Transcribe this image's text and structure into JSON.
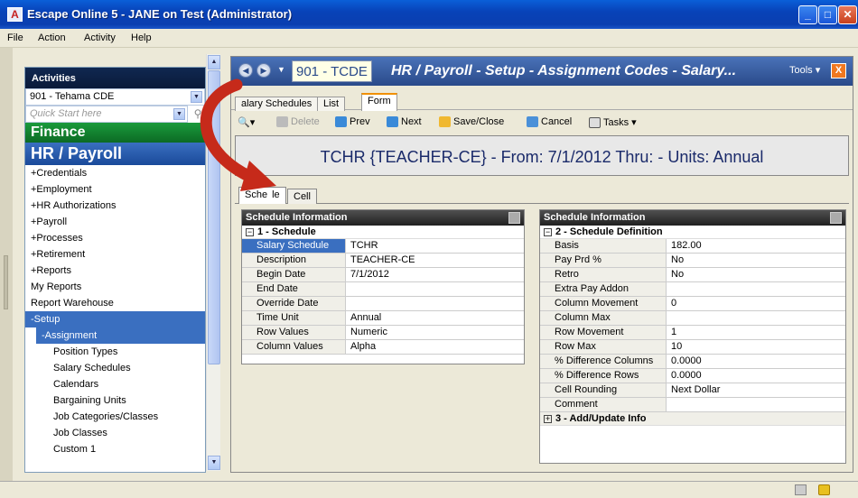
{
  "window": {
    "title": "Escape Online 5 - JANE on Test (Administrator)",
    "app_icon_letter": "A"
  },
  "menu": [
    "File",
    "Action",
    "Activity",
    "Help"
  ],
  "activities": {
    "title": "Activities",
    "district": "901 - Tehama CDE",
    "quick_start_placeholder": "Quick Start here",
    "finance": "Finance",
    "hr_payroll": "HR / Payroll",
    "items": [
      "+Credentials",
      "+Employment",
      "+HR Authorizations",
      "+Payroll",
      "+Processes",
      "+Retirement",
      "+Reports",
      "My Reports",
      "Report Warehouse"
    ],
    "setup": "-Setup",
    "assignment": "-Assignment",
    "sub_items": [
      "Position Types",
      "Salary Schedules",
      "Calendars",
      "Bargaining Units",
      "Job Categories/Classes",
      "Job Classes",
      "Custom 1"
    ]
  },
  "main": {
    "code": "901 - TCDE",
    "title": "HR / Payroll - Setup - Assignment Codes - Salary...",
    "tools": "Tools ▾",
    "close": "X",
    "tabs": [
      "alary Schedules",
      "List",
      "Form"
    ],
    "toolbar": {
      "delete": "Delete",
      "prev": "Prev",
      "next": "Next",
      "save_close": "Save/Close",
      "cancel": "Cancel",
      "tasks": "Tasks"
    },
    "banner": "TCHR {TEACHER-CE}  -  From: 7/1/2012 Thru:   -  Units: Annual",
    "subtabs": [
      "Sche",
      "le",
      "Cell"
    ]
  },
  "left_pane": {
    "header": "Schedule Information",
    "section": "1 - Schedule",
    "rows": [
      {
        "k": "Salary Schedule",
        "v": "TCHR"
      },
      {
        "k": "Description",
        "v": "TEACHER-CE"
      },
      {
        "k": "Begin Date",
        "v": "7/1/2012"
      },
      {
        "k": "End Date",
        "v": ""
      },
      {
        "k": "Override Date",
        "v": ""
      },
      {
        "k": "Time Unit",
        "v": "Annual"
      },
      {
        "k": "Row Values",
        "v": "Numeric"
      },
      {
        "k": "Column Values",
        "v": "Alpha"
      }
    ]
  },
  "right_pane": {
    "header": "Schedule Information",
    "section": "2 - Schedule Definition",
    "rows": [
      {
        "k": "Basis",
        "v": "182.00"
      },
      {
        "k": "Pay Prd %",
        "v": "No"
      },
      {
        "k": "Retro",
        "v": "No"
      },
      {
        "k": "Extra Pay Addon",
        "v": ""
      },
      {
        "k": "Column Movement",
        "v": "0"
      },
      {
        "k": "Column Max",
        "v": ""
      },
      {
        "k": "Row Movement",
        "v": "1"
      },
      {
        "k": "Row Max",
        "v": "10"
      },
      {
        "k": "% Difference Columns",
        "v": "0.0000"
      },
      {
        "k": "% Difference Rows",
        "v": "0.0000"
      },
      {
        "k": "Cell Rounding",
        "v": "Next Dollar"
      },
      {
        "k": "Comment",
        "v": ""
      }
    ],
    "section3": "3 - Add/Update Info"
  }
}
